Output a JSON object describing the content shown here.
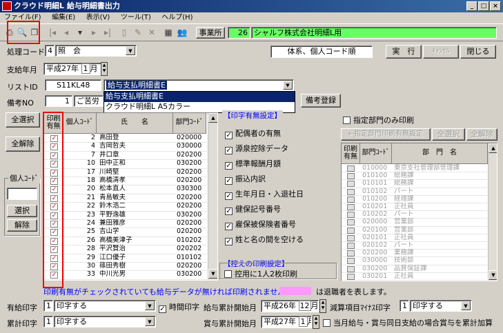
{
  "window": {
    "title": "クラウド明細L 給与明細書出力"
  },
  "menu": [
    "ファイル(F)",
    "編集(E)",
    "表示(V)",
    "ツール(T)",
    "ヘルプ(H)"
  ],
  "office": {
    "label": "事業所",
    "code": "26",
    "name": "シャルフ株式会社明細L用"
  },
  "process": {
    "label": "処理コード",
    "code": "4",
    "value": "照　会"
  },
  "order_note": "体系、個人コード順",
  "buttons": {
    "run": "実　行",
    "cancel": "ｷｬﾝｾﾙ",
    "close": "閉じる",
    "remark_register": "備考登録",
    "select_all": "全選択",
    "clear_all": "全解除",
    "select": "選択",
    "release": "解除",
    "dept_toggle": "←指定部門印刷有無設定",
    "dept_select_all": "全選択",
    "dept_clear_all": "全解除"
  },
  "pay_month": {
    "label": "支給年月",
    "era": "平成27",
    "year_suffix": "年",
    "month": "1",
    "month_suffix": "月"
  },
  "list_id": {
    "label": "リストID",
    "code": "S11KL48",
    "value": "給与支払明細書E",
    "options": [
      "給与支払明細書E",
      "クラウド明細L A5カラー"
    ]
  },
  "remark": {
    "label": "備考NO",
    "no": "1",
    "text": "ご苦労"
  },
  "personal_code_label": "個人ｺｰﾄﾞ",
  "emp_grid": {
    "headers": [
      "印刷有無",
      "個人ｺｰﾄﾞ",
      "氏　　名",
      "部門ｺｰﾄﾞ"
    ],
    "rows": [
      {
        "code": "2",
        "name": "高田登",
        "dept": "020000"
      },
      {
        "code": "4",
        "name": "吉岡哲夫",
        "dept": "030000"
      },
      {
        "code": "7",
        "name": "井口章",
        "dept": "020200"
      },
      {
        "code": "10",
        "name": "田中正和",
        "dept": "030200"
      },
      {
        "code": "17",
        "name": "川崎堅",
        "dept": "020200"
      },
      {
        "code": "18",
        "name": "高橋清孝",
        "dept": "020200"
      },
      {
        "code": "20",
        "name": "松本直人",
        "dept": "030300"
      },
      {
        "code": "21",
        "name": "青島敏夫",
        "dept": "020200"
      },
      {
        "code": "22",
        "name": "鈴木浩二",
        "dept": "020200"
      },
      {
        "code": "23",
        "name": "平野逸雄",
        "dept": "030200"
      },
      {
        "code": "24",
        "name": "兼田雅彦",
        "dept": "020200"
      },
      {
        "code": "25",
        "name": "吉山学",
        "dept": "020200"
      },
      {
        "code": "26",
        "name": "高橋美津子",
        "dept": "010202"
      },
      {
        "code": "28",
        "name": "平沢賢治",
        "dept": "020202"
      },
      {
        "code": "29",
        "name": "江口優子",
        "dept": "010102"
      },
      {
        "code": "30",
        "name": "篠田秀樹",
        "dept": "020200"
      },
      {
        "code": "33",
        "name": "中川光男",
        "dept": "030200"
      }
    ]
  },
  "print_settings": {
    "title": "【印字有無設定】",
    "items": [
      {
        "label": "配偶者の有無",
        "checked": true
      },
      {
        "label": "源泉控除データ",
        "checked": true
      },
      {
        "label": "標準報酬月額",
        "checked": true
      },
      {
        "label": "振込内訳",
        "checked": true
      },
      {
        "label": "生年月日・入退社日",
        "checked": true
      },
      {
        "label": "健保記号番号",
        "checked": true
      },
      {
        "label": "雇保被保険者番号",
        "checked": true
      },
      {
        "label": "姓と名の間を空ける",
        "checked": true
      }
    ]
  },
  "copy_settings": {
    "title": "【控えの印刷設定】",
    "item": "控用に1人2枚印刷"
  },
  "dept_only": "指定部門のみ印刷",
  "dept_grid": {
    "headers": [
      "印刷有無",
      "部門ｺｰﾄﾞ",
      "部　門　名"
    ],
    "rows": [
      {
        "code": "010000",
        "name": "東京支社管理部管理課"
      },
      {
        "code": "010100",
        "name": "総務課"
      },
      {
        "code": "010101",
        "name": "総務課"
      },
      {
        "code": "010102",
        "name": "パート"
      },
      {
        "code": "010200",
        "name": "経理課"
      },
      {
        "code": "010201",
        "name": "正社員"
      },
      {
        "code": "010202",
        "name": "パート"
      },
      {
        "code": "020000",
        "name": "営業部"
      },
      {
        "code": "020100",
        "name": "営業部"
      },
      {
        "code": "020101",
        "name": "正社員"
      },
      {
        "code": "020102",
        "name": "パート"
      },
      {
        "code": "020200",
        "name": "業務課"
      },
      {
        "code": "030000",
        "name": "技術部"
      },
      {
        "code": "030200",
        "name": "品質保証課"
      },
      {
        "code": "030201",
        "name": "正社員"
      }
    ]
  },
  "notice": "印刷有無がチェックされていても給与データが無ければ印刷されません。",
  "retiree_note": "は退職者を表します。",
  "colors": {
    "notice": "#0000ff",
    "retiree": "#ff99ff",
    "office_bg": "#66ff66",
    "check": "#cc0000"
  },
  "footer": {
    "salary_print": {
      "label": "有給印字",
      "code": "1",
      "value": "印字する"
    },
    "time_print": "時間印字",
    "pay_total_start": {
      "label": "給与累計開始月",
      "era": "平成26",
      "year_suffix": "年",
      "month": "12",
      "month_suffix": "月"
    },
    "deduct_minus": {
      "label": "減算項目ﾏｲﾅｽ印字",
      "code": "1",
      "value": "印字する"
    },
    "total_print": {
      "label": "累計印字",
      "code": "1",
      "value": "印字する"
    },
    "bonus_total_start": {
      "label": "賞与累計開始月",
      "era": "平成27",
      "year_suffix": "年",
      "month": "1",
      "month_suffix": "月"
    },
    "same_day_note": "当月給与・賞与同日支給の場合賞与を累計加算"
  }
}
